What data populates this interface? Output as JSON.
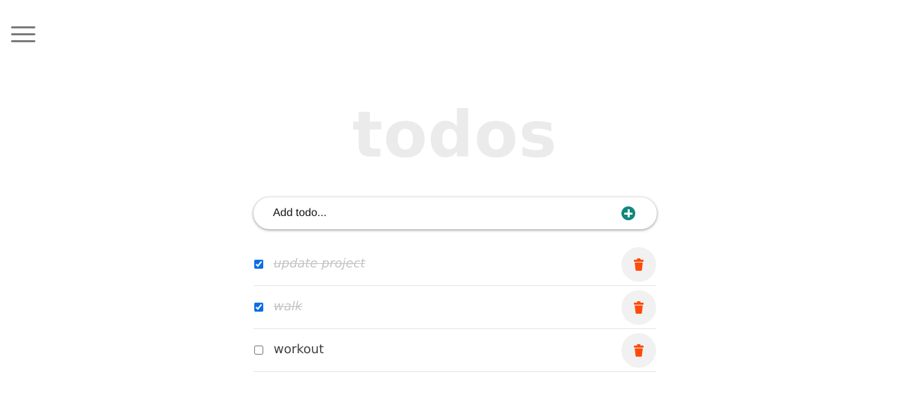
{
  "header": {
    "menu_icon": "hamburger-menu-icon",
    "title": "todos"
  },
  "add_form": {
    "placeholder": "Add todo...",
    "value": "",
    "add_icon": "plus-circle-icon",
    "add_icon_color": "#10897b"
  },
  "todos": [
    {
      "text": "update project",
      "completed": true
    },
    {
      "text": "walk",
      "completed": true
    },
    {
      "text": "workout",
      "completed": false
    }
  ],
  "delete_icon": "trash-icon",
  "colors": {
    "delete_icon": "#ff4b0a",
    "title": "#ebebeb",
    "completed_text": "#c4c4c4",
    "checkbox_accent": "#0b6ee8"
  }
}
